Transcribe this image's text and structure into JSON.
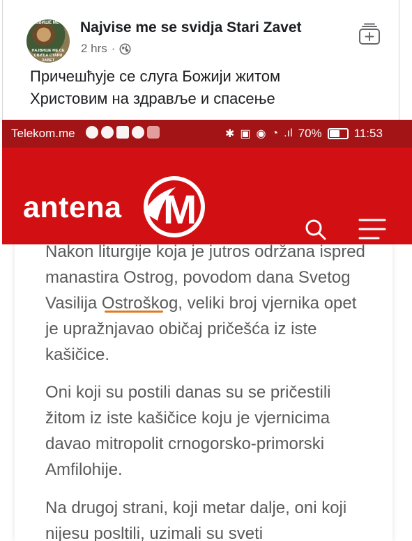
{
  "post": {
    "page_name": "Najvise me se svidja Stari Zavet",
    "time": "2 hrs",
    "separator": "·",
    "avatar_top_text": "НАЈВИШЕ МЕ СЕ",
    "avatar_bottom_text": "НАЈВИШЕ МЕ СЕ СВИЂА СТАРИ ЗАВЕТ",
    "text_line1": "Причешћује се слуга Божији житом",
    "text_line2": "Христовим на здравље и спасење",
    "icons": {
      "audience": "globe-icon",
      "save": "save-collection-icon"
    }
  },
  "statusbar": {
    "carrier": "Telekom.me",
    "battery": "70%",
    "battery_level": 0.7,
    "time": "11:53",
    "bluetooth": "✱",
    "signal": ".ıl"
  },
  "site": {
    "logo_text": "antena",
    "logo_mark": "M",
    "brand_color": "#d21013",
    "statusbar_color": "#a31416",
    "icons": {
      "search": "search-icon",
      "menu": "hamburger-menu-icon"
    }
  },
  "article": {
    "p1": "Nakon liturgije koja je jutros održana ispred manastira Ostrog, povodom dana Svetog Vasilija Ostroškog, veliki broj vjernika opet je upražnjavao običaj pričešća iz iste kašičice.",
    "p2_before": "Oni koji su postili danas su se pričestili ",
    "p2_highlight": "žitom",
    "p2_after": " iz iste kašičice koju je vjernicima davao mitropolit crnogorsko-primorski Amfilohije.",
    "p3": "Na drugoj strani, koji metar dalje, oni koji nijesu posltili, uzimali su sveti",
    "highlight_color": "#e07a22"
  }
}
